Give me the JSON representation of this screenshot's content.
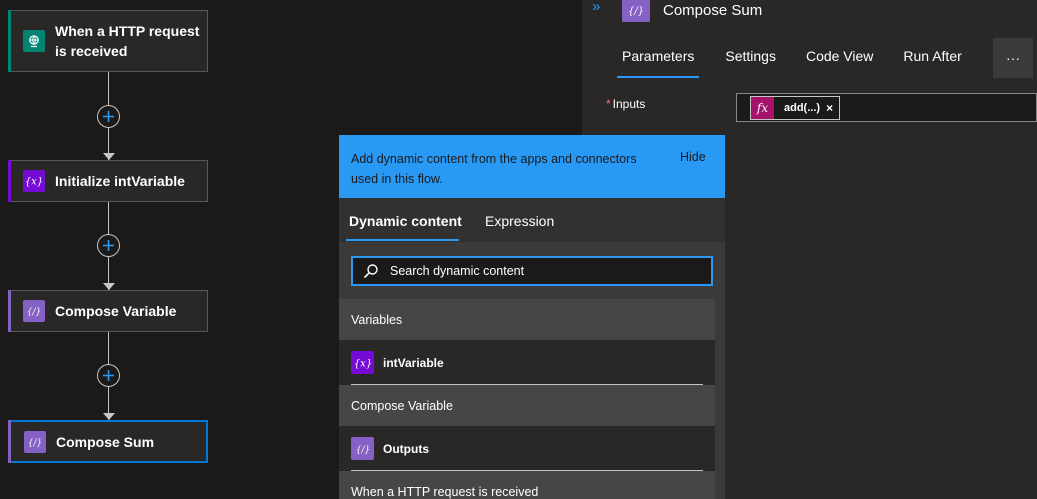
{
  "flow": {
    "nodes": [
      {
        "title": "When a HTTP request is received",
        "title_line1": "When a HTTP request",
        "title_line2": "is received",
        "icon": "globe-icon",
        "color": "#008575"
      },
      {
        "title": "Initialize intVariable",
        "icon": "variable-icon",
        "color": "#770bd6"
      },
      {
        "title": "Compose Variable",
        "icon": "compose-icon",
        "color": "#8661c5"
      },
      {
        "title": "Compose Sum",
        "icon": "compose-icon",
        "color": "#8661c5",
        "selected": true
      }
    ]
  },
  "panel": {
    "title": "Compose Sum",
    "collapse_glyph": "»",
    "tabs": [
      "Parameters",
      "Settings",
      "Code View",
      "Run After"
    ],
    "active_tab": "Parameters",
    "more_label": "···",
    "inputs_label": "Inputs",
    "inputs_required_marker": "*",
    "token": {
      "fx": "fx",
      "label": "add(...)",
      "remove": "×",
      "color": "#a4126a"
    }
  },
  "dynamic_popup": {
    "banner_text": "Add dynamic content from the apps and connectors used in this flow.",
    "hide_label": "Hide",
    "tabs": [
      "Dynamic content",
      "Expression"
    ],
    "active_tab": "Dynamic content",
    "search_placeholder": "Search dynamic content",
    "sections": [
      {
        "header": "Variables",
        "items": [
          {
            "label": "intVariable",
            "icon": "variable-icon",
            "color": "#770bd6"
          }
        ]
      },
      {
        "header": "Compose Variable",
        "items": [
          {
            "label": "Outputs",
            "icon": "compose-icon",
            "color": "#8661c5"
          }
        ]
      },
      {
        "header": "When a HTTP request is received",
        "items": []
      }
    ]
  },
  "colors": {
    "accent": "#2899f5",
    "selected_border": "#0078d4",
    "background": "#1b1a19"
  }
}
